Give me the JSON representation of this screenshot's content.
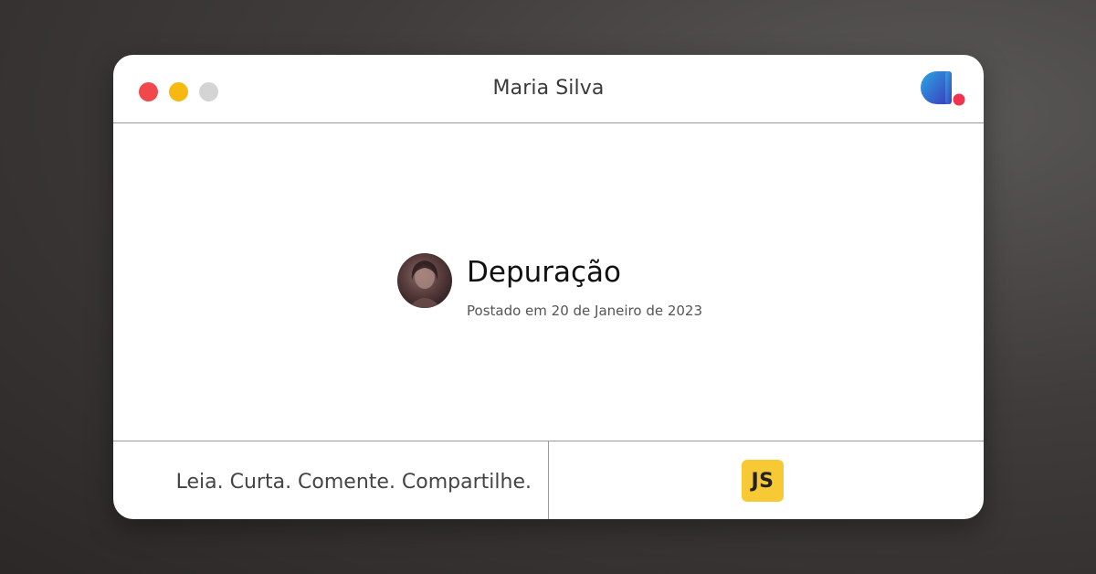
{
  "window": {
    "title": "Maria Silva",
    "controls": [
      {
        "name": "close",
        "color": "#f0484b"
      },
      {
        "name": "minimize",
        "color": "#f6b811"
      },
      {
        "name": "zoom",
        "color": "#d4d4d4"
      }
    ]
  },
  "brand": {
    "icon": "dev-community-logo-icon",
    "colors": {
      "gradient_start": "#2aa8e3",
      "gradient_end": "#3b3fbf",
      "dot": "#f0344f"
    }
  },
  "post": {
    "title": "Depuração",
    "date": "Postado em 20 de Janeiro de 2023",
    "avatar_icon": "author-avatar"
  },
  "footer": {
    "tagline": "Leia. Curta. Comente. Compartilhe.",
    "tag_badge": {
      "label": "JS",
      "color": "#f7c935"
    }
  }
}
